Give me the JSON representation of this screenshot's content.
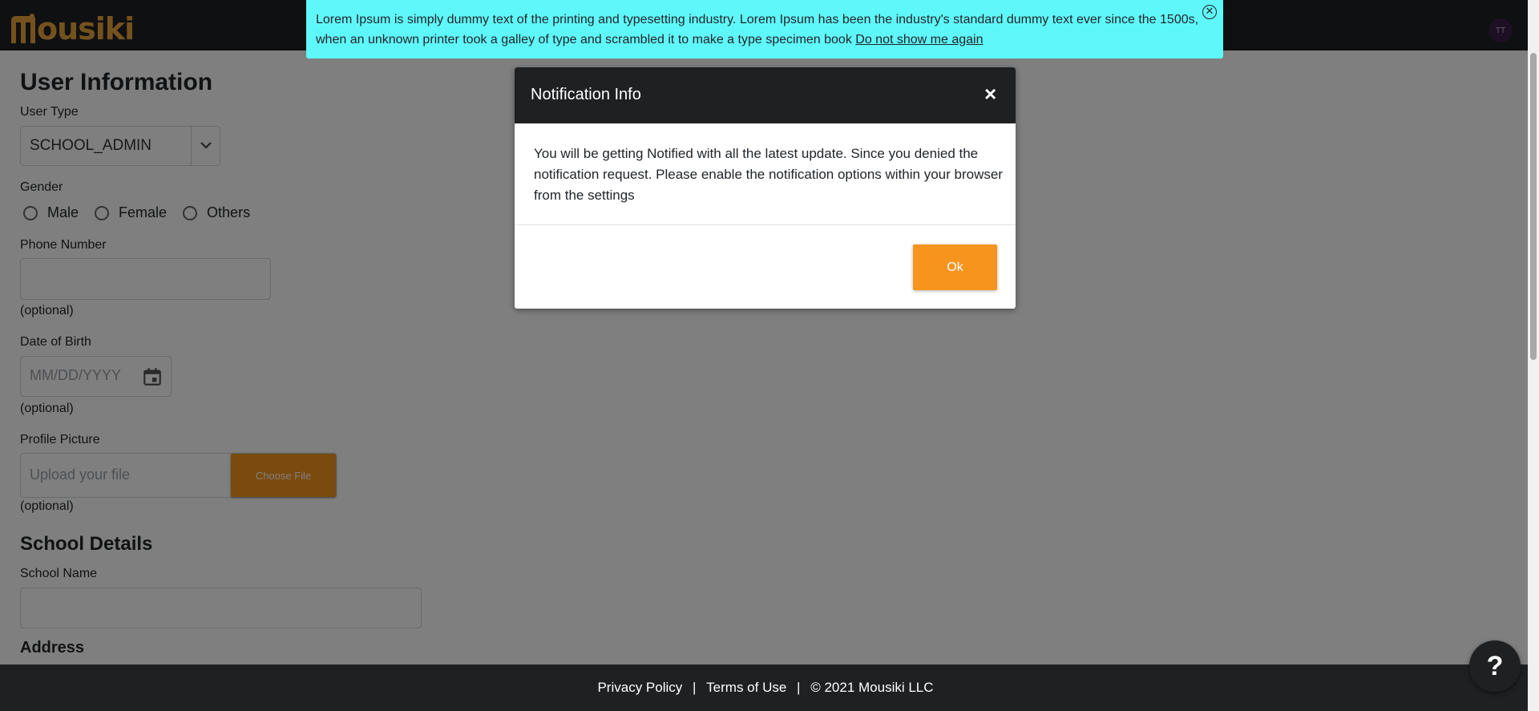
{
  "header": {
    "logo_text": "ousiki",
    "avatar_initials": "TT"
  },
  "banner": {
    "text": "Lorem Ipsum is simply dummy text of the printing and typesetting industry. Lorem Ipsum has been the industry's standard dummy text ever since the 1500s, when an unknown printer took a galley of type and scrambled it to make a type specimen book",
    "link": "Do not show me again",
    "close_icon": "close-circle-icon"
  },
  "form": {
    "title": "User Information",
    "user_type": {
      "label": "User Type",
      "value": "SCHOOL_ADMIN"
    },
    "gender": {
      "label": "Gender",
      "options": [
        "Male",
        "Female",
        "Others"
      ]
    },
    "phone": {
      "label": "Phone Number",
      "hint": "(optional)"
    },
    "dob": {
      "label": "Date of Birth",
      "placeholder": "MM/DD/YYYY",
      "hint": "(optional)"
    },
    "profile_picture": {
      "label": "Profile Picture",
      "placeholder": "Upload your file",
      "button": "Choose File",
      "hint": "(optional)"
    },
    "school_section": "School Details",
    "school_name": {
      "label": "School Name"
    },
    "address_section": "Address"
  },
  "modal": {
    "title": "Notification Info",
    "body": "You will be getting Notified with all the latest update. Since you denied the notification request. Please enable the notification options within your browser from the settings",
    "ok": "Ok"
  },
  "footer": {
    "privacy": "Privacy Policy",
    "sep": "|",
    "terms": "Terms of Use",
    "copyright": "© 2021 Mousiki LLC"
  },
  "help": {
    "label": "?"
  },
  "colors": {
    "accent": "#f7941d",
    "dark": "#1f2022",
    "banner": "#5ff8fa"
  }
}
